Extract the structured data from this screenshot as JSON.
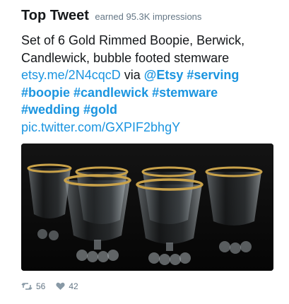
{
  "header": {
    "title": "Top Tweet",
    "subtitle": "earned 95.3K impressions"
  },
  "tweet": {
    "text_line1": "Set of 6 Gold Rimmed Boopie, Berwick,",
    "text_line2": "Candlewick, bubble footed stemware",
    "link": "etsy.me/2N4cqcD",
    "via": "via",
    "mention": "@Etsy",
    "tags": [
      "#serving",
      "#boopie",
      "#candlewick",
      "#stemware",
      "#wedding",
      "#gold"
    ],
    "pic_link": "pic.twitter.com/GXPIF2bhgY"
  },
  "stats": {
    "retweets": "56",
    "likes": "42"
  },
  "colors": {
    "link": "#1b95e0",
    "muted": "#657786",
    "text": "#14171a",
    "rim_gold": "#c9a24a"
  },
  "icons": {
    "retweet": "retweet-icon",
    "like": "heart-icon"
  }
}
